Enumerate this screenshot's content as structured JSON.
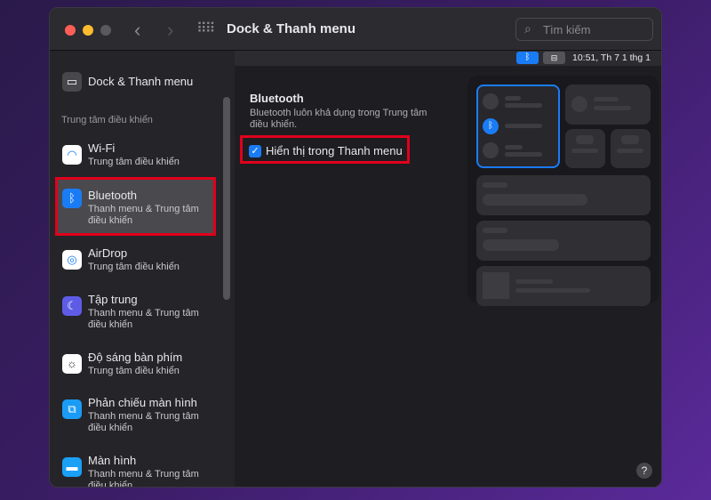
{
  "window": {
    "title": "Dock & Thanh menu",
    "search_placeholder": "Tìm kiếm"
  },
  "menubar": {
    "clock": "10:51, Th 7 1 thg 1"
  },
  "sidebar": {
    "top_item": "Dock & Thanh menu",
    "section": "Trung tâm điều khiển",
    "items": [
      {
        "label": "Wi-Fi",
        "sub": "Trung tâm điều khiển",
        "icon": "wifi-icon",
        "color": "#ffffff"
      },
      {
        "label": "Bluetooth",
        "sub": "Thanh menu & Trung tâm điều khiển",
        "icon": "bluetooth-icon",
        "color": "#1a7cf5"
      },
      {
        "label": "AirDrop",
        "sub": "Trung tâm điều khiển",
        "icon": "airdrop-icon",
        "color": "#ffffff"
      },
      {
        "label": "Tập trung",
        "sub": "Thanh menu & Trung tâm điều khiển",
        "icon": "moon-icon",
        "color": "#5e5ce6"
      },
      {
        "label": "Độ sáng bàn phím",
        "sub": "Trung tâm điều khiển",
        "icon": "keyboard-brightness-icon",
        "color": "#ffffff"
      },
      {
        "label": "Phản chiếu màn hình",
        "sub": "Thanh menu & Trung tâm điều khiển",
        "icon": "screen-mirroring-icon",
        "color": "#1a9bf5"
      },
      {
        "label": "Màn hình",
        "sub": "Thanh menu & Trung tâm điều khiển",
        "icon": "display-icon",
        "color": "#1aa0f5"
      }
    ]
  },
  "main": {
    "heading": "Bluetooth",
    "desc": "Bluetooth luôn khả dụng trong Trung tâm điều khiển.",
    "checkbox_label": "Hiển thị trong Thanh menu",
    "checked": true,
    "help": "?"
  }
}
